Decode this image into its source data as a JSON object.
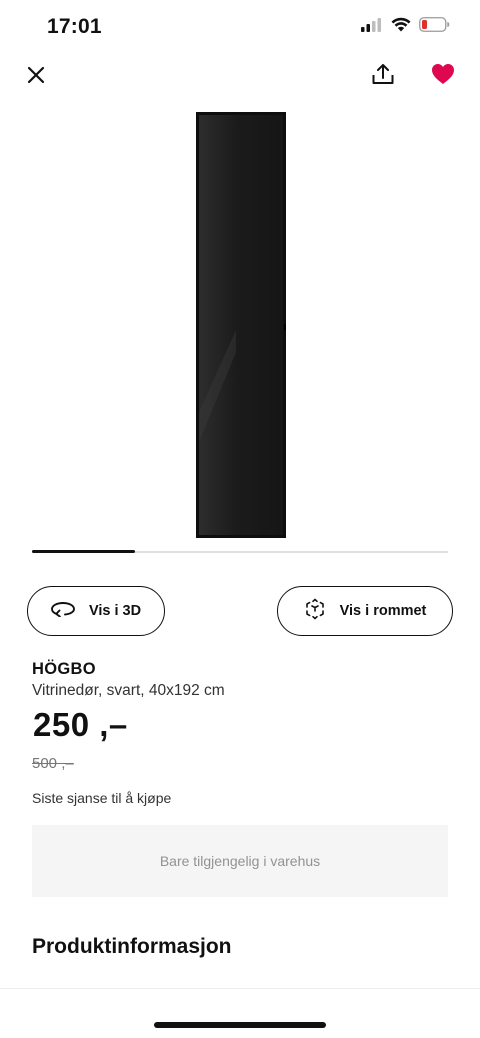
{
  "status_bar": {
    "time": "17:01",
    "signal_icon": "cellular-signal-icon",
    "wifi_icon": "wifi-icon",
    "battery_icon": "battery-low-icon",
    "battery_color": "#e0302b"
  },
  "nav": {
    "close_icon": "close-icon",
    "share_icon": "share-icon",
    "favorite_icon": "heart-icon",
    "favorite_color": "#e00751"
  },
  "gallery": {
    "image_name": "black-glass-door-image",
    "active_slide": 1,
    "total_slides": 4
  },
  "actions": {
    "view_3d_label": "Vis i 3D",
    "view_room_label": "Vis i rommet"
  },
  "product": {
    "name": "HÖGBO",
    "description": "Vitrinedør, svart, 40x192 cm",
    "price": "250 ,–",
    "old_price": "500 ,–",
    "note": "Siste sjanse til å kjøpe"
  },
  "availability": {
    "label": "Bare tilgjengelig i varehus"
  },
  "sections": {
    "product_info_title": "Produktinformasjon"
  },
  "colors": {
    "text_primary": "#111111",
    "muted": "#929292",
    "availability_bg": "#f5f5f5"
  }
}
